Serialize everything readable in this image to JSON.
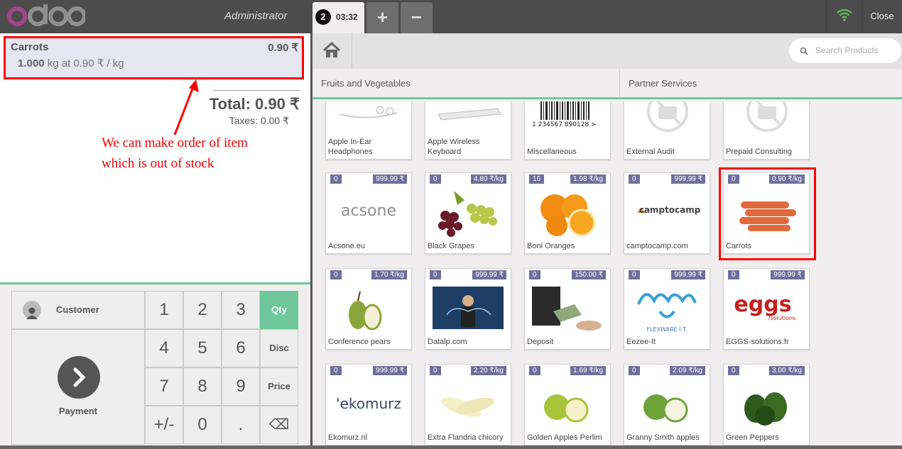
{
  "topbar": {
    "user": "Administrator",
    "order_number": "2",
    "order_time": "03:32",
    "add_label": "+",
    "remove_label": "−",
    "close_label": "Close"
  },
  "order": {
    "line": {
      "name": "Carrots",
      "price": "0.90 ₹",
      "qty": "1.000",
      "unit_info": " kg at 0.90 ₹ / kg"
    },
    "total": "Total: 0.90 ₹",
    "taxes": "Taxes: 0.00 ₹"
  },
  "annotation": "We can make order of item which is out of stock",
  "pad": {
    "customer": "Customer",
    "payment": "Payment",
    "keys": [
      "1",
      "2",
      "3",
      "Qty",
      "4",
      "5",
      "6",
      "Disc",
      "7",
      "8",
      "9",
      "Price",
      "+/-",
      "0",
      ".",
      "⌫"
    ]
  },
  "search": {
    "placeholder": "Search Products"
  },
  "categories": [
    "Fruits and Vegetables",
    "Partner Services"
  ],
  "products_top": [
    "Apple In-Ear Headphones",
    "Apple Wireless Keyboard",
    "Miscellaneous",
    "External Audit",
    "Prepaid Consulting"
  ],
  "barcode_text": "1 234567 890128 >",
  "products": [
    {
      "name": "Acsone.eu",
      "stock": "0",
      "price": "999.99 ₹"
    },
    {
      "name": "Black Grapes",
      "stock": "0",
      "price": "4.80 ₹/kg"
    },
    {
      "name": "Boni Oranges",
      "stock": "16",
      "price": "1.98 ₹/kg"
    },
    {
      "name": "camptocamp.com",
      "stock": "0",
      "price": "999.99 ₹"
    },
    {
      "name": "Carrots",
      "stock": "0",
      "price": "0.90 ₹/kg"
    },
    {
      "name": "Conference pears",
      "stock": "0",
      "price": "1.70 ₹/kg"
    },
    {
      "name": "Datalp.com",
      "stock": "0",
      "price": "999.99 ₹"
    },
    {
      "name": "Deposit",
      "stock": "0",
      "price": "150.00 ₹"
    },
    {
      "name": "Eezee-It",
      "stock": "0",
      "price": "999.99 ₹"
    },
    {
      "name": "EGGS-solutions.fr",
      "stock": "0",
      "price": "999.99 ₹"
    },
    {
      "name": "Ekomurz.nl",
      "stock": "0",
      "price": "999.99 ₹"
    },
    {
      "name": "Extra Flandria chicory",
      "stock": "0",
      "price": "2.20 ₹/kg"
    },
    {
      "name": "Golden Apples Perlim",
      "stock": "0",
      "price": "1.69 ₹/kg"
    },
    {
      "name": "Granny Smith apples",
      "stock": "0",
      "price": "2.09 ₹/kg"
    },
    {
      "name": "Green Peppers",
      "stock": "0",
      "price": "3.00 ₹/kg"
    }
  ],
  "logos": {
    "acsone": "acsone",
    "camptocamp": "camptocamp",
    "eezee_sub": "FLEXWARE I.T.",
    "eggs": "eggs",
    "eggs_sub": "/solutions",
    "ekomurz": "'ekomurz"
  },
  "colors": {
    "accent": "#6ec89b",
    "badge": "#6f6f9d",
    "highlight": "#ff0000",
    "annotation": "#ee0000"
  }
}
